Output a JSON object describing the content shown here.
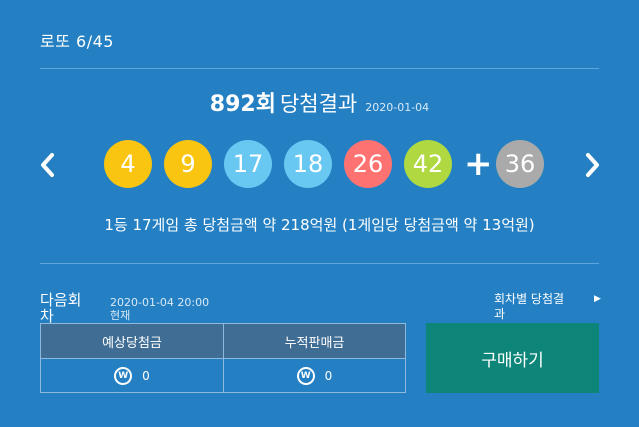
{
  "app": {
    "title": "로또 6/45"
  },
  "draw": {
    "round": "892회",
    "label": "당첨결과",
    "date": "2020-01-04",
    "balls": [
      {
        "number": "4",
        "color": "#f9c510"
      },
      {
        "number": "9",
        "color": "#f9c510"
      },
      {
        "number": "17",
        "color": "#69c8f2"
      },
      {
        "number": "18",
        "color": "#69c8f2"
      },
      {
        "number": "26",
        "color": "#ff7272"
      },
      {
        "number": "42",
        "color": "#b0d840"
      }
    ],
    "plus": "+",
    "bonus": {
      "number": "36",
      "color": "#aaaaaa"
    },
    "summary": "1등 17게임 총 당첨금액 약 218억원 (1게임당 당첨금액 약 13억원)"
  },
  "next": {
    "label": "다음회차",
    "datetime": "2020-01-04 20:00 현재"
  },
  "history": {
    "label": "회차별 당첨결과"
  },
  "stats": {
    "expected_label": "예상당첨금",
    "expected_value": "0",
    "cumulative_label": "누적판매금",
    "cumulative_value": "0",
    "currency_symbol": "W"
  },
  "buy": {
    "label": "구매하기"
  }
}
